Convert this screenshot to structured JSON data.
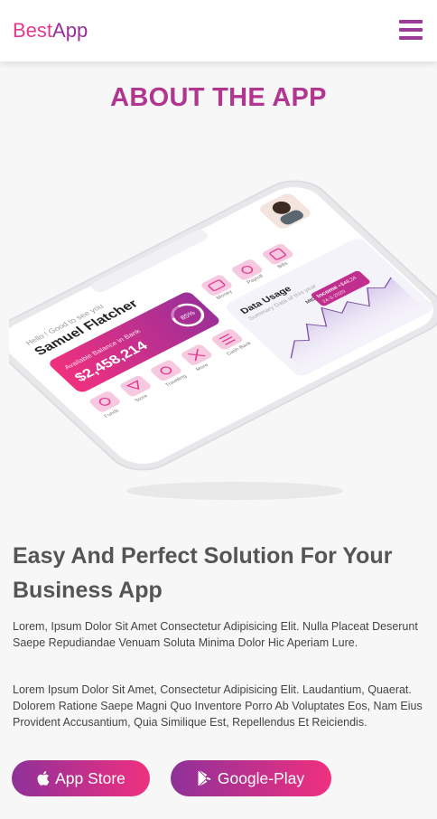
{
  "brand": {
    "part1": "Best",
    "part2": "App"
  },
  "about": {
    "title": "ABOUT THE APP"
  },
  "mockup": {
    "greeting": "Hello ! Good to see you",
    "user_name": "Samuel Flatcher",
    "balance_label": "Available Balance in Bank",
    "balance_value": "$2,458,214",
    "progress_value": "85%",
    "menu_items": [
      "Money",
      "Payroll",
      "Bills",
      "Funds",
      "Store",
      "Traveling",
      "More",
      "Cash Back"
    ],
    "data_usage_title": "Data Usage",
    "data_usage_subtitle": "Summary Data of this year",
    "tooltip_label": "Income",
    "tooltip_amount": "+$48,34",
    "tooltip_date": "24-3-2020",
    "chart_marker": "MID"
  },
  "content": {
    "headline": "Easy And Perfect Solution For Your Business App",
    "paragraph1": "Lorem, Ipsum Dolor Sit Amet Consectetur Adipisicing Elit. Nulla Placeat Deserunt Saepe Repudiandae Venuam Soluta Minima Dolor Hic Aperiam Lure.",
    "paragraph2": "Lorem Ipsum Dolor Sit Amet, Consectetur Adipisicing Elit. Laudantium, Quaerat. Dolorem Ratione Saepe Magni Quo Inventore Porro Ab Voluptates Eos, Nam Eius Provident Accusantium, Quia Similique Est, Repellendus Et Reiciendis."
  },
  "buttons": {
    "app_store": "App Store",
    "google_play": "Google-Play"
  },
  "colors": {
    "pink": "#e4388f",
    "purple": "#9b2f98",
    "gradient_start": "#8f3199",
    "gradient_end": "#f0307f"
  }
}
